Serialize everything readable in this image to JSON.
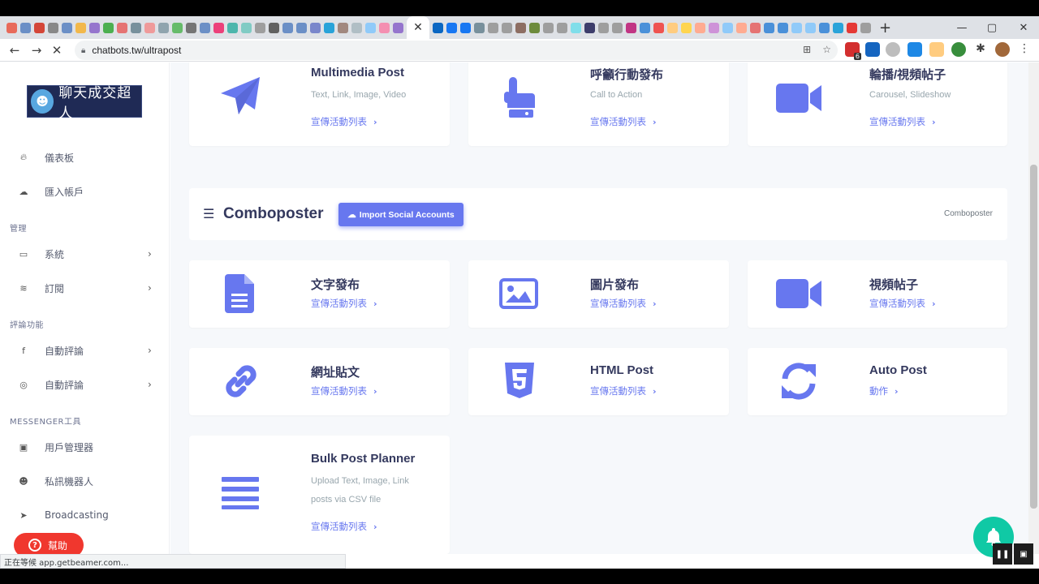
{
  "browser": {
    "url": "chatbots.tw/ultrapost",
    "status_text": "正在等候 app.getbeamer.com...",
    "extension_badge": "6"
  },
  "sidebar": {
    "logo_text": "聊天成交超人",
    "items": [
      {
        "label": "儀表板",
        "icon": "fire-icon"
      },
      {
        "label": "匯入帳戶",
        "icon": "cloud-upload-icon"
      }
    ],
    "heading_manage": "管理",
    "manage_items": [
      {
        "label": "系統",
        "icon": "laptop-icon"
      },
      {
        "label": "訂閱",
        "icon": "coins-icon"
      }
    ],
    "heading_comments": "評論功能",
    "comment_items": [
      {
        "label": "自動評論",
        "icon": "facebook-icon"
      },
      {
        "label": "自動評論",
        "icon": "instagram-icon"
      }
    ],
    "heading_messenger": "MESSENGER工具",
    "messenger_items": [
      {
        "label": "用戶管理器",
        "icon": "user-card-icon"
      },
      {
        "label": "私訊機器人",
        "icon": "robot-icon"
      },
      {
        "label": "Broadcasting",
        "icon": "paper-plane-icon"
      }
    ],
    "help_label": "幫助"
  },
  "top_cards": [
    {
      "title": "Multimedia Post",
      "subtitle": "Text, Link, Image, Video",
      "link": "宣傳活動列表",
      "icon": "paper-plane-icon"
    },
    {
      "title": "呼籲行動發布",
      "subtitle": "Call to Action",
      "link": "宣傳活動列表",
      "icon": "hand-pointer-icon"
    },
    {
      "title": "輪播/視頻帖子",
      "subtitle": "Carousel, Slideshow",
      "link": "宣傳活動列表",
      "icon": "video-camera-icon"
    }
  ],
  "combo_section": {
    "title": "Comboposter",
    "import_button": "Import Social Accounts",
    "breadcrumb": "Comboposter"
  },
  "combo_cards": [
    {
      "title": "文字發布",
      "link": "宣傳活動列表",
      "icon": "file-text-icon"
    },
    {
      "title": "圖片發布",
      "link": "宣傳活動列表",
      "icon": "image-icon"
    },
    {
      "title": "視頻帖子",
      "link": "宣傳活動列表",
      "icon": "video-camera-icon"
    },
    {
      "title": "網址貼文",
      "link": "宣傳活動列表",
      "icon": "link-icon"
    },
    {
      "title": "HTML Post",
      "link": "宣傳活動列表",
      "icon": "html5-icon"
    },
    {
      "title": "Auto Post",
      "link": "動作",
      "icon": "sync-icon"
    }
  ],
  "bulk_card": {
    "title": "Bulk Post Planner",
    "subtitle_line1": "Upload Text, Image, Link",
    "subtitle_line2": "posts via CSV file",
    "link": "宣傳活動列表",
    "icon": "bars-icon"
  },
  "colors": {
    "accent": "#6777ef",
    "help_red": "#f0372e",
    "bell_green": "#10c9a5"
  }
}
